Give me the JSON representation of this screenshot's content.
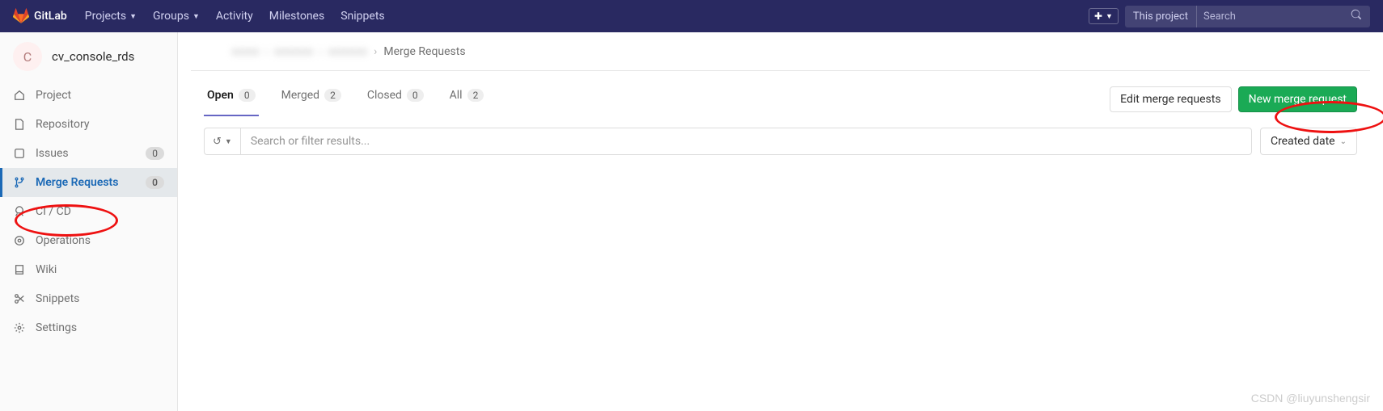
{
  "header": {
    "brand": "GitLab",
    "nav": {
      "projects": "Projects",
      "groups": "Groups",
      "activity": "Activity",
      "milestones": "Milestones",
      "snippets": "Snippets"
    },
    "scope": "This project",
    "search_placeholder": "Search"
  },
  "sidebar": {
    "project_initial": "C",
    "project_name": "cv_console_rds",
    "items": [
      {
        "label": "Project"
      },
      {
        "label": "Repository"
      },
      {
        "label": "Issues",
        "count": "0"
      },
      {
        "label": "Merge Requests",
        "count": "0"
      },
      {
        "label": "CI / CD"
      },
      {
        "label": "Operations"
      },
      {
        "label": "Wiki"
      },
      {
        "label": "Snippets"
      },
      {
        "label": "Settings"
      }
    ]
  },
  "breadcrumb": {
    "current": "Merge Requests"
  },
  "tabs": {
    "open": {
      "label": "Open",
      "count": "0"
    },
    "merged": {
      "label": "Merged",
      "count": "2"
    },
    "closed": {
      "label": "Closed",
      "count": "0"
    },
    "all": {
      "label": "All",
      "count": "2"
    }
  },
  "buttons": {
    "edit": "Edit merge requests",
    "new": "New merge request",
    "sort": "Created date"
  },
  "filter": {
    "placeholder": "Search or filter results..."
  },
  "watermark": "CSDN @liuyunshengsir"
}
